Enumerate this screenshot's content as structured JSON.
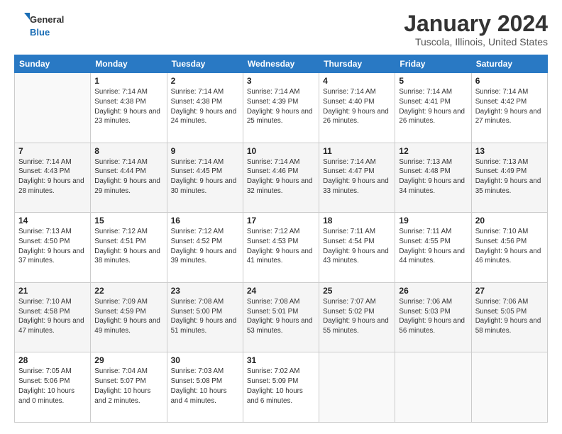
{
  "logo": {
    "line1": "General",
    "line2": "Blue"
  },
  "title": "January 2024",
  "subtitle": "Tuscola, Illinois, United States",
  "days_of_week": [
    "Sunday",
    "Monday",
    "Tuesday",
    "Wednesday",
    "Thursday",
    "Friday",
    "Saturday"
  ],
  "weeks": [
    [
      {
        "day": "",
        "sunrise": "",
        "sunset": "",
        "daylight": ""
      },
      {
        "day": "1",
        "sunrise": "Sunrise: 7:14 AM",
        "sunset": "Sunset: 4:38 PM",
        "daylight": "Daylight: 9 hours and 23 minutes."
      },
      {
        "day": "2",
        "sunrise": "Sunrise: 7:14 AM",
        "sunset": "Sunset: 4:38 PM",
        "daylight": "Daylight: 9 hours and 24 minutes."
      },
      {
        "day": "3",
        "sunrise": "Sunrise: 7:14 AM",
        "sunset": "Sunset: 4:39 PM",
        "daylight": "Daylight: 9 hours and 25 minutes."
      },
      {
        "day": "4",
        "sunrise": "Sunrise: 7:14 AM",
        "sunset": "Sunset: 4:40 PM",
        "daylight": "Daylight: 9 hours and 26 minutes."
      },
      {
        "day": "5",
        "sunrise": "Sunrise: 7:14 AM",
        "sunset": "Sunset: 4:41 PM",
        "daylight": "Daylight: 9 hours and 26 minutes."
      },
      {
        "day": "6",
        "sunrise": "Sunrise: 7:14 AM",
        "sunset": "Sunset: 4:42 PM",
        "daylight": "Daylight: 9 hours and 27 minutes."
      }
    ],
    [
      {
        "day": "7",
        "sunrise": "Sunrise: 7:14 AM",
        "sunset": "Sunset: 4:43 PM",
        "daylight": "Daylight: 9 hours and 28 minutes."
      },
      {
        "day": "8",
        "sunrise": "Sunrise: 7:14 AM",
        "sunset": "Sunset: 4:44 PM",
        "daylight": "Daylight: 9 hours and 29 minutes."
      },
      {
        "day": "9",
        "sunrise": "Sunrise: 7:14 AM",
        "sunset": "Sunset: 4:45 PM",
        "daylight": "Daylight: 9 hours and 30 minutes."
      },
      {
        "day": "10",
        "sunrise": "Sunrise: 7:14 AM",
        "sunset": "Sunset: 4:46 PM",
        "daylight": "Daylight: 9 hours and 32 minutes."
      },
      {
        "day": "11",
        "sunrise": "Sunrise: 7:14 AM",
        "sunset": "Sunset: 4:47 PM",
        "daylight": "Daylight: 9 hours and 33 minutes."
      },
      {
        "day": "12",
        "sunrise": "Sunrise: 7:13 AM",
        "sunset": "Sunset: 4:48 PM",
        "daylight": "Daylight: 9 hours and 34 minutes."
      },
      {
        "day": "13",
        "sunrise": "Sunrise: 7:13 AM",
        "sunset": "Sunset: 4:49 PM",
        "daylight": "Daylight: 9 hours and 35 minutes."
      }
    ],
    [
      {
        "day": "14",
        "sunrise": "Sunrise: 7:13 AM",
        "sunset": "Sunset: 4:50 PM",
        "daylight": "Daylight: 9 hours and 37 minutes."
      },
      {
        "day": "15",
        "sunrise": "Sunrise: 7:12 AM",
        "sunset": "Sunset: 4:51 PM",
        "daylight": "Daylight: 9 hours and 38 minutes."
      },
      {
        "day": "16",
        "sunrise": "Sunrise: 7:12 AM",
        "sunset": "Sunset: 4:52 PM",
        "daylight": "Daylight: 9 hours and 39 minutes."
      },
      {
        "day": "17",
        "sunrise": "Sunrise: 7:12 AM",
        "sunset": "Sunset: 4:53 PM",
        "daylight": "Daylight: 9 hours and 41 minutes."
      },
      {
        "day": "18",
        "sunrise": "Sunrise: 7:11 AM",
        "sunset": "Sunset: 4:54 PM",
        "daylight": "Daylight: 9 hours and 43 minutes."
      },
      {
        "day": "19",
        "sunrise": "Sunrise: 7:11 AM",
        "sunset": "Sunset: 4:55 PM",
        "daylight": "Daylight: 9 hours and 44 minutes."
      },
      {
        "day": "20",
        "sunrise": "Sunrise: 7:10 AM",
        "sunset": "Sunset: 4:56 PM",
        "daylight": "Daylight: 9 hours and 46 minutes."
      }
    ],
    [
      {
        "day": "21",
        "sunrise": "Sunrise: 7:10 AM",
        "sunset": "Sunset: 4:58 PM",
        "daylight": "Daylight: 9 hours and 47 minutes."
      },
      {
        "day": "22",
        "sunrise": "Sunrise: 7:09 AM",
        "sunset": "Sunset: 4:59 PM",
        "daylight": "Daylight: 9 hours and 49 minutes."
      },
      {
        "day": "23",
        "sunrise": "Sunrise: 7:08 AM",
        "sunset": "Sunset: 5:00 PM",
        "daylight": "Daylight: 9 hours and 51 minutes."
      },
      {
        "day": "24",
        "sunrise": "Sunrise: 7:08 AM",
        "sunset": "Sunset: 5:01 PM",
        "daylight": "Daylight: 9 hours and 53 minutes."
      },
      {
        "day": "25",
        "sunrise": "Sunrise: 7:07 AM",
        "sunset": "Sunset: 5:02 PM",
        "daylight": "Daylight: 9 hours and 55 minutes."
      },
      {
        "day": "26",
        "sunrise": "Sunrise: 7:06 AM",
        "sunset": "Sunset: 5:03 PM",
        "daylight": "Daylight: 9 hours and 56 minutes."
      },
      {
        "day": "27",
        "sunrise": "Sunrise: 7:06 AM",
        "sunset": "Sunset: 5:05 PM",
        "daylight": "Daylight: 9 hours and 58 minutes."
      }
    ],
    [
      {
        "day": "28",
        "sunrise": "Sunrise: 7:05 AM",
        "sunset": "Sunset: 5:06 PM",
        "daylight": "Daylight: 10 hours and 0 minutes."
      },
      {
        "day": "29",
        "sunrise": "Sunrise: 7:04 AM",
        "sunset": "Sunset: 5:07 PM",
        "daylight": "Daylight: 10 hours and 2 minutes."
      },
      {
        "day": "30",
        "sunrise": "Sunrise: 7:03 AM",
        "sunset": "Sunset: 5:08 PM",
        "daylight": "Daylight: 10 hours and 4 minutes."
      },
      {
        "day": "31",
        "sunrise": "Sunrise: 7:02 AM",
        "sunset": "Sunset: 5:09 PM",
        "daylight": "Daylight: 10 hours and 6 minutes."
      },
      {
        "day": "",
        "sunrise": "",
        "sunset": "",
        "daylight": ""
      },
      {
        "day": "",
        "sunrise": "",
        "sunset": "",
        "daylight": ""
      },
      {
        "day": "",
        "sunrise": "",
        "sunset": "",
        "daylight": ""
      }
    ]
  ]
}
